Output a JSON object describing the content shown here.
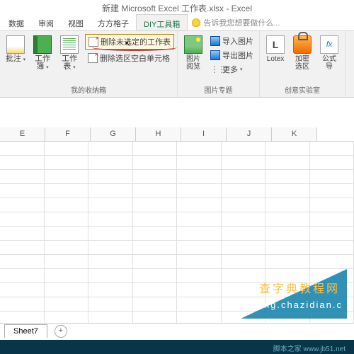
{
  "title": "新建 Microsoft Excel 工作表.xlsx - Excel",
  "tabs": {
    "t1": "数据",
    "t2": "审阅",
    "t3": "视图",
    "t4": "方方格子",
    "t5": "DIY工具箱",
    "tell": "告诉我您想要做什么..."
  },
  "g1": {
    "title": "我的收纳箱",
    "b1": "批注",
    "b2": "工作\n簿",
    "b3": "工作\n表",
    "i1": "删除未选定的工作表",
    "i2": "删除选区空白单元格"
  },
  "g2": {
    "title": "图片专题",
    "b1": "图片\n阅览",
    "i1": "导入图片",
    "i2": "导出图片",
    "i3": "更多"
  },
  "g3": {
    "title": "创意实验室",
    "b1": "Lotex",
    "b2": "加密\n选区",
    "b3": "公式\n导"
  },
  "cols": [
    "E",
    "F",
    "G",
    "H",
    "I",
    "J",
    "K"
  ],
  "sheet": "Sheet7",
  "wm1": "查字典教程网",
  "wm2": "jiaocheng.chazidian.c",
  "foot": "脚本之家 www.jb51.net"
}
